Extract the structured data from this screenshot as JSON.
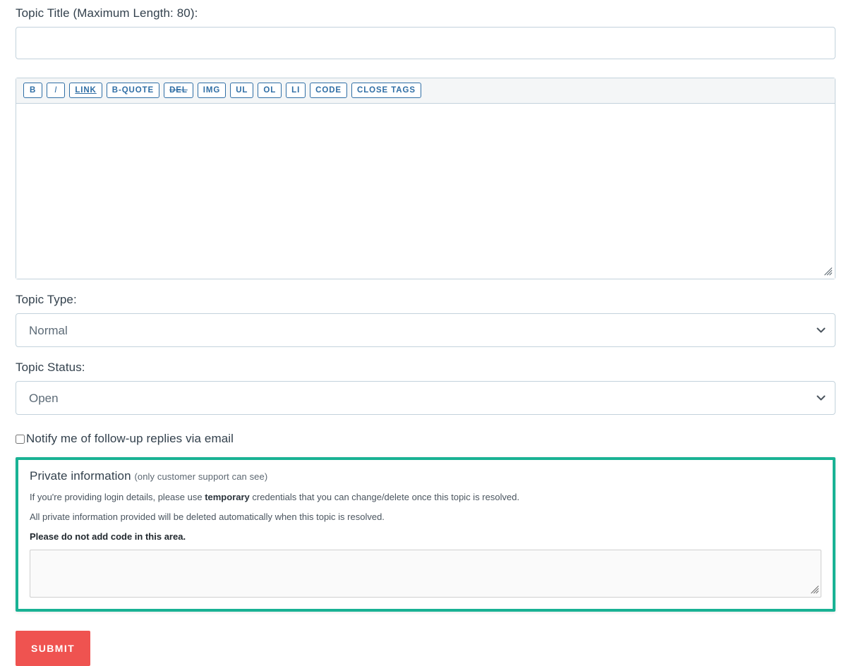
{
  "form": {
    "title_label": "Topic Title (Maximum Length: 80):",
    "title_value": "",
    "title_placeholder": "",
    "body_value": "",
    "body_placeholder": "",
    "topic_type_label": "Topic Type:",
    "topic_type_value": "Normal",
    "topic_type_options": [
      "Normal"
    ],
    "topic_status_label": "Topic Status:",
    "topic_status_value": "Open",
    "topic_status_options": [
      "Open"
    ],
    "notify_label": "Notify me of follow-up replies via email",
    "notify_checked": false
  },
  "toolbar": {
    "buttons": [
      {
        "label": "B",
        "name": "bold-button"
      },
      {
        "label": "I",
        "name": "italic-button"
      },
      {
        "label": "LINK",
        "name": "link-button"
      },
      {
        "label": "B-QUOTE",
        "name": "blockquote-button"
      },
      {
        "label": "DEL",
        "name": "del-button"
      },
      {
        "label": "IMG",
        "name": "img-button"
      },
      {
        "label": "UL",
        "name": "ul-button"
      },
      {
        "label": "OL",
        "name": "ol-button"
      },
      {
        "label": "LI",
        "name": "li-button"
      },
      {
        "label": "CODE",
        "name": "code-button"
      },
      {
        "label": "CLOSE TAGS",
        "name": "close-tags-button"
      }
    ]
  },
  "private": {
    "heading": "Private information",
    "heading_sub": "(only customer support can see)",
    "note1_before": "If you're providing login details, please use ",
    "note1_bold": "temporary",
    "note1_after": " credentials that you can change/delete once this topic is resolved.",
    "note2": "All private information provided will be deleted automatically when this topic is resolved.",
    "note3": "Please do not add code in this area.",
    "textarea_value": "",
    "textarea_placeholder": ""
  },
  "actions": {
    "submit_label": "SUBMIT"
  },
  "colors": {
    "accent_green": "#19b294",
    "submit_red": "#ef5350",
    "toolbar_blue": "#2f6ea5",
    "input_border": "#c3d2dc"
  }
}
